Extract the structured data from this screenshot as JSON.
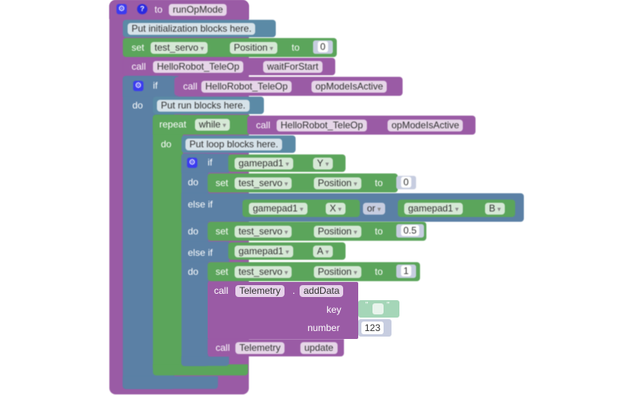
{
  "procedure": {
    "to_label": "to",
    "name": "runOpMode",
    "init_comment": "Put initialization blocks here.",
    "init_set": {
      "set_label": "set",
      "device": "test_servo",
      "property": "Position",
      "to_label": "to",
      "value": "0"
    },
    "wait_call": {
      "call_label": "call",
      "object": "HelloRobot_TeleOp",
      "method": "waitForStart"
    }
  },
  "if_block": {
    "if_label": "if",
    "do_label": "do",
    "condition": {
      "call_label": "call",
      "object": "HelloRobot_TeleOp",
      "method": "opModeIsActive"
    },
    "run_comment": "Put run blocks here."
  },
  "repeat_block": {
    "repeat_label": "repeat",
    "mode": "while",
    "do_label": "do",
    "condition": {
      "call_label": "call",
      "object": "HelloRobot_TeleOp",
      "method": "opModeIsActive"
    },
    "loop_comment": "Put loop blocks here."
  },
  "inner_if": {
    "if_label": "if",
    "do_label": "do",
    "else_if_label": "else if",
    "cond1": {
      "gamepad": "gamepad1",
      "button": "Y"
    },
    "set1": {
      "set_label": "set",
      "device": "test_servo",
      "property": "Position",
      "to_label": "to",
      "value": "0"
    },
    "cond2": {
      "left": {
        "gamepad": "gamepad1",
        "button": "X"
      },
      "operator": "or",
      "right": {
        "gamepad": "gamepad1",
        "button": "B"
      }
    },
    "set2": {
      "set_label": "set",
      "device": "test_servo",
      "property": "Position",
      "to_label": "to",
      "value": "0.5"
    },
    "cond3": {
      "gamepad": "gamepad1",
      "button": "A"
    },
    "set3": {
      "set_label": "set",
      "device": "test_servo",
      "property": "Position",
      "to_label": "to",
      "value": "1"
    }
  },
  "telemetry_add": {
    "call_label": "call",
    "object": "Telemetry",
    "method": "addData",
    "key_label": "key",
    "key_value": "",
    "number_label": "number",
    "number_value": "123"
  },
  "telemetry_update": {
    "call_label": "call",
    "object": "Telemetry",
    "method": "update"
  },
  "icons": {
    "gear": "⚙",
    "help": "?"
  }
}
